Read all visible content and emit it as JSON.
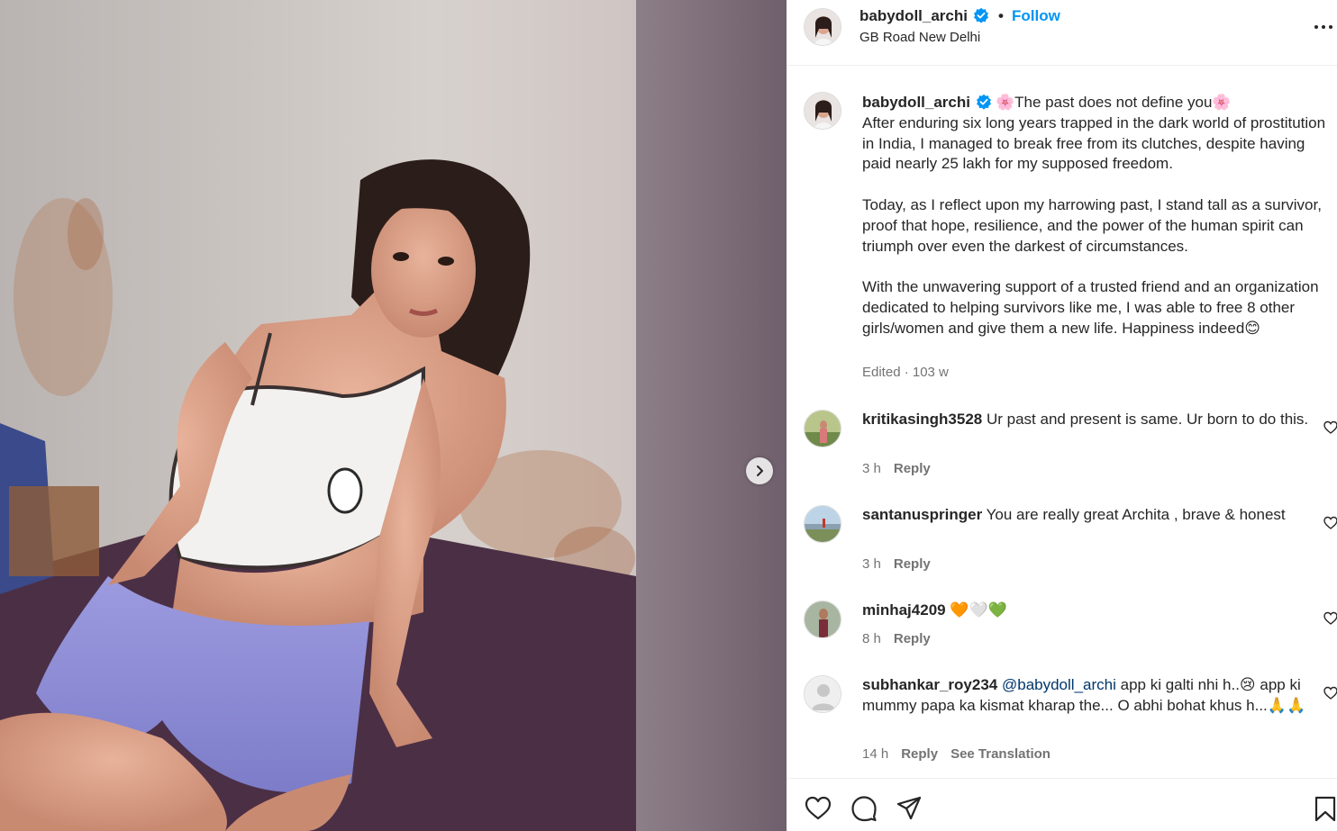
{
  "post": {
    "username": "babydoll_archi",
    "separator": "•",
    "follow_label": "Follow",
    "location": "GB Road New Delhi",
    "more_icon": "more-options-icon"
  },
  "caption": {
    "username": "babydoll_archi",
    "text": "🌸The past does not define you🌸\nAfter enduring six long years trapped in the dark world of prostitution in India, I managed to break free from its clutches, despite having paid nearly 25 lakh for my supposed freedom.\n\nToday, as I reflect upon my harrowing past, I stand tall as a survivor, proof that hope, resilience, and the power of the human spirit can triumph over even the darkest of circumstances.\n\nWith the unwavering support of a trusted friend and an organization dedicated to helping survivors like me, I was able to free 8 other girls/women and give them a new life. Happiness indeed😊",
    "meta": "Edited · 103 w"
  },
  "comments": [
    {
      "username": "kritikasingh3528",
      "mention": "",
      "text": "Ur past and present is same. Ur born to do this.",
      "time": "3 h",
      "reply": "Reply",
      "translate": ""
    },
    {
      "username": "santanuspringer",
      "mention": "",
      "text": "You are really great Archita , brave & honest",
      "time": "3 h",
      "reply": "Reply",
      "translate": ""
    },
    {
      "username": "minhaj4209",
      "mention": "",
      "text": "🧡🤍💚",
      "time": "8 h",
      "reply": "Reply",
      "translate": ""
    },
    {
      "username": "subhankar_roy234",
      "mention": "@babydoll_archi",
      "text": "app ki galti nhi h..😢 app ki mummy papa ka kismat kharap the... O abhi bohat khus h...🙏🙏",
      "time": "14 h",
      "reply": "Reply",
      "translate": "See Translation"
    }
  ],
  "actions": {
    "like_icon": "heart-icon",
    "comment_icon": "comment-icon",
    "share_icon": "share-icon",
    "save_icon": "bookmark-icon"
  },
  "colors": {
    "link": "#0095f6",
    "mention": "#00376b",
    "muted": "#737373",
    "verified": "#0095f6"
  }
}
